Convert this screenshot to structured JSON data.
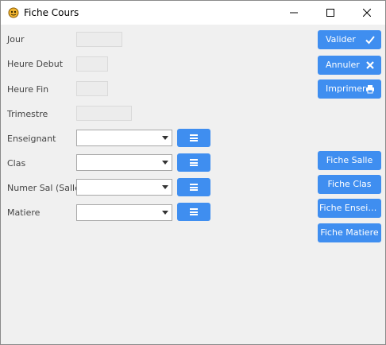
{
  "window": {
    "title": "Fiche Cours"
  },
  "form": {
    "jour_label": "Jour",
    "heure_debut_label": "Heure Debut",
    "heure_fin_label": "Heure Fin",
    "trimestre_label": "Trimestre",
    "enseignant_label": "Enseignant",
    "clas_label": "Clas",
    "numer_sal_label": "Numer Sal (Salle)",
    "matiere_label": "Matiere"
  },
  "actions": {
    "valider": "Valider",
    "annuler": "Annuler",
    "imprimer": "Imprimer",
    "fiche_salle": "Fiche Salle",
    "fiche_clas": "Fiche Clas",
    "fiche_enseignant": "Fiche Enseig...",
    "fiche_matiere": "Fiche Matiere"
  },
  "colors": {
    "accent": "#3f8ef0",
    "background": "#f0f0f0"
  }
}
